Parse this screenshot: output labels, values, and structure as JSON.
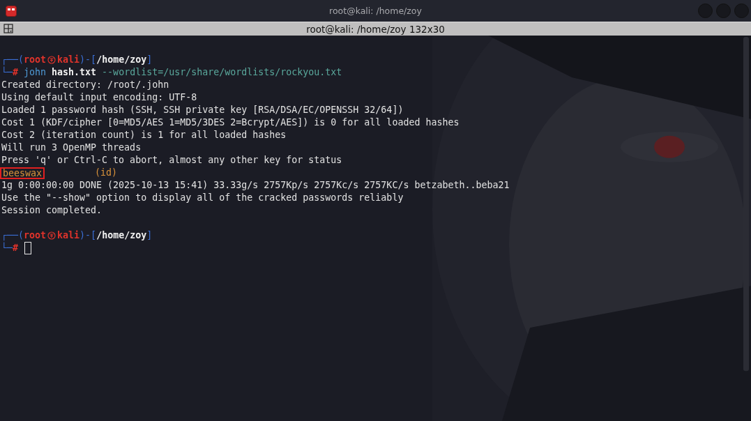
{
  "window": {
    "title": "root@kali: /home/zoy"
  },
  "tab": {
    "title": "root@kali: /home/zoy 132x30"
  },
  "terminal": {
    "lines": [
      {
        "kind": "blank"
      },
      {
        "kind": "prompt",
        "corner": "┌──(",
        "user": "root",
        "host": "kali",
        "sep": ")-[",
        "path": "/home/zoy",
        "close": "]"
      },
      {
        "kind": "command",
        "corner": "└─",
        "hash": "#",
        "program": "john",
        "file": "hash.txt",
        "args": "--wordlist=/usr/share/wordlists/rockyou.txt"
      },
      {
        "kind": "output",
        "text": "Created directory: /root/.john"
      },
      {
        "kind": "output",
        "text": "Using default input encoding: UTF-8"
      },
      {
        "kind": "output",
        "text": "Loaded 1 password hash (SSH, SSH private key [RSA/DSA/EC/OPENSSH 32/64])"
      },
      {
        "kind": "output",
        "text": "Cost 1 (KDF/cipher [0=MD5/AES 1=MD5/3DES 2=Bcrypt/AES]) is 0 for all loaded hashes"
      },
      {
        "kind": "output",
        "text": "Cost 2 (iteration count) is 1 for all loaded hashes"
      },
      {
        "kind": "output",
        "text": "Will run 3 OpenMP threads"
      },
      {
        "kind": "output",
        "text": "Press 'q' or Ctrl-C to abort, almost any other key for status"
      },
      {
        "kind": "result",
        "password": "beeswax",
        "highlighted": true,
        "user": "(id)"
      },
      {
        "kind": "output",
        "text": "1g 0:00:00:00 DONE (2025-10-13 15:41) 33.33g/s 2757Kp/s 2757Kc/s 2757KC/s betzabeth..beba21"
      },
      {
        "kind": "output",
        "text": "Use the \"--show\" option to display all of the cracked passwords reliably"
      },
      {
        "kind": "output",
        "text": "Session completed."
      },
      {
        "kind": "blank"
      },
      {
        "kind": "prompt",
        "corner": "┌──(",
        "user": "root",
        "host": "kali",
        "sep": ")-[",
        "path": "/home/zoy",
        "close": "]"
      },
      {
        "kind": "input",
        "corner": "└─",
        "hash": "#",
        "cursor": true
      }
    ]
  }
}
